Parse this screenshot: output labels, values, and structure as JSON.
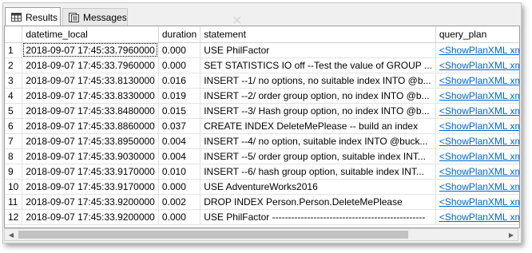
{
  "tabs": [
    {
      "label": "Results",
      "icon": "grid-icon",
      "active": true
    },
    {
      "label": "Messages",
      "icon": "messages-icon",
      "active": false
    }
  ],
  "columns": [
    "",
    "datetime_local",
    "duration",
    "statement",
    "query_plan"
  ],
  "rows": [
    {
      "n": "1",
      "datetime_local": "2018-09-07 17:45:33.7960000",
      "duration": "0.000",
      "statement": "USE PhilFactor",
      "query_plan": "<ShowPlanXML xmlns"
    },
    {
      "n": "2",
      "datetime_local": "2018-09-07 17:45:33.7960000",
      "duration": "0.000",
      "statement": "SET STATISTICS IO off --Test the value of GROUP ...",
      "query_plan": "<ShowPlanXML xmlns"
    },
    {
      "n": "3",
      "datetime_local": "2018-09-07 17:45:33.8130000",
      "duration": "0.016",
      "statement": "INSERT --1/ no options, no suitable index   INTO @b...",
      "query_plan": "<ShowPlanXML xmlns"
    },
    {
      "n": "4",
      "datetime_local": "2018-09-07 17:45:33.8330000",
      "duration": "0.019",
      "statement": "INSERT  --2/ order group option, no index   INTO @b...",
      "query_plan": "<ShowPlanXML xmlns"
    },
    {
      "n": "5",
      "datetime_local": "2018-09-07 17:45:33.8480000",
      "duration": "0.015",
      "statement": "INSERT  --3/ Hash group option, no index   INTO @b...",
      "query_plan": "<ShowPlanXML xmlns"
    },
    {
      "n": "6",
      "datetime_local": "2018-09-07 17:45:33.8860000",
      "duration": "0.037",
      "statement": "CREATE INDEX DeleteMePlease -- build an index",
      "query_plan": "<ShowPlanXML xmlns"
    },
    {
      "n": "7",
      "datetime_local": "2018-09-07 17:45:33.8950000",
      "duration": "0.004",
      "statement": "INSERT  --4/ no option, suitable index   INTO @buck...",
      "query_plan": "<ShowPlanXML xmlns"
    },
    {
      "n": "8",
      "datetime_local": "2018-09-07 17:45:33.9030000",
      "duration": "0.004",
      "statement": "INSERT  --5/ order group option, suitable index   INT...",
      "query_plan": "<ShowPlanXML xmlns"
    },
    {
      "n": "9",
      "datetime_local": "2018-09-07 17:45:33.9170000",
      "duration": "0.010",
      "statement": "INSERT  --6/ hash group option, suitable index   INT...",
      "query_plan": "<ShowPlanXML xmlns"
    },
    {
      "n": "10",
      "datetime_local": "2018-09-07 17:45:33.9170000",
      "duration": "0.000",
      "statement": "USE AdventureWorks2016",
      "query_plan": "<ShowPlanXML xmlns"
    },
    {
      "n": "11",
      "datetime_local": "2018-09-07 17:45:33.9200000",
      "duration": "0.002",
      "statement": "DROP INDEX Person.Person.DeleteMePlease",
      "query_plan": "<ShowPlanXML xmlns"
    },
    {
      "n": "12",
      "datetime_local": "2018-09-07 17:45:33.9200000",
      "duration": "0.000",
      "statement": "USE PhilFactor   ------------------------------------------------",
      "query_plan": "<ShowPlanXML xmlns"
    }
  ],
  "colors": {
    "link": "#0066cc",
    "tab_border": "#9c9c9c",
    "scroll_thumb": "#c2c2c2"
  }
}
